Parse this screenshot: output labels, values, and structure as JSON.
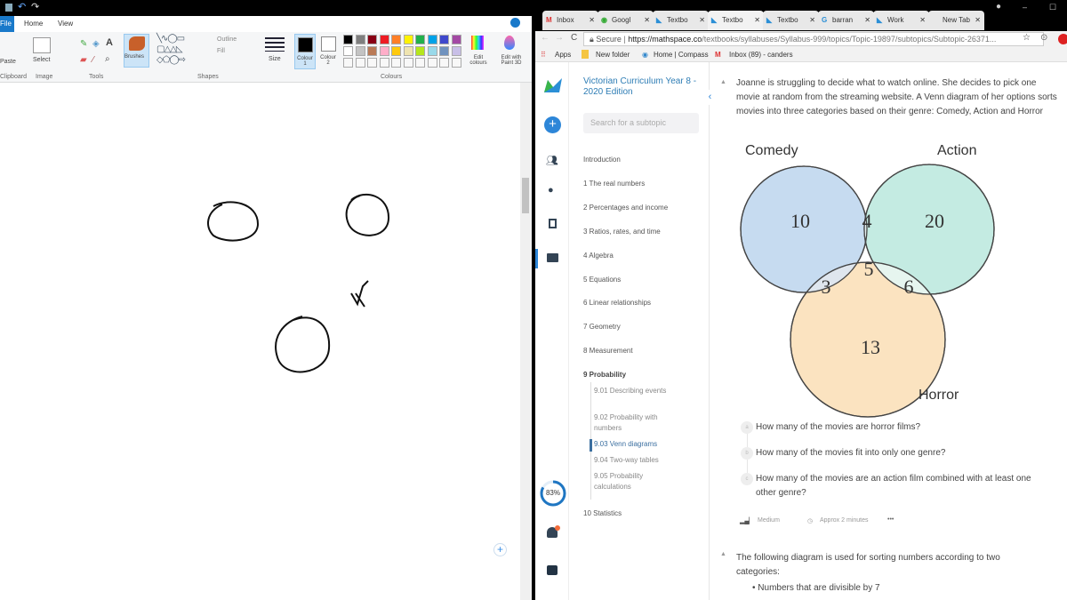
{
  "paint": {
    "quick_access": [
      "save-icon",
      "undo-icon",
      "redo-icon"
    ],
    "tabs": [
      "File",
      "Home",
      "View"
    ],
    "groups": {
      "clipboard": "Clipboard",
      "image": "Image",
      "tools": "Tools",
      "shapes": "Shapes",
      "colours": "Colours"
    },
    "buttons": {
      "paste": "Paste",
      "select": "Select",
      "brushes": "Brushes",
      "outline": "Outline",
      "fill": "Fill",
      "size": "Size",
      "colour1": "Colour 1",
      "colour2": "Colour 2",
      "edit_colours": "Edit colours",
      "edit_paint3d": "Edit with Paint 3D"
    },
    "palette_row1": [
      "#000000",
      "#7f7f7f",
      "#880015",
      "#ed1c24",
      "#ff7f27",
      "#fff200",
      "#22b14c",
      "#00a2e8",
      "#3f48cc",
      "#a349a4"
    ],
    "palette_row2": [
      "#ffffff",
      "#c3c3c3",
      "#b97a57",
      "#ffaec9",
      "#ffc90e",
      "#efe4b0",
      "#b5e61d",
      "#99d9ea",
      "#7092be",
      "#c8bfe7"
    ],
    "colour1": "#000000",
    "colour2": "#ffffff"
  },
  "browser": {
    "tabs": [
      {
        "label": "Inbox",
        "icon": "gmail-icon"
      },
      {
        "label": "Googl",
        "icon": "google-icon"
      },
      {
        "label": "Textbo",
        "icon": "mathspace-icon"
      },
      {
        "label": "Textbo",
        "icon": "mathspace-icon",
        "active": true
      },
      {
        "label": "Textbo",
        "icon": "mathspace-icon"
      },
      {
        "label": "barran",
        "icon": "google-g-icon"
      },
      {
        "label": "Work",
        "icon": "mathspace-icon"
      },
      {
        "label": "New Tab",
        "icon": ""
      }
    ],
    "secure": "Secure",
    "url_domain": "https://mathspace.co",
    "url_path": "/textbooks/syllabuses/Syllabus-999/topics/Topic-19897/subtopics/Subtopic-26371...",
    "bookmarks": [
      "Apps",
      "New folder",
      "Home | Compass",
      "Inbox (89) - canders"
    ]
  },
  "mathspace": {
    "sidebar": {
      "title": "Victorian Curriculum Year 8 - 2020 Edition",
      "search_placeholder": "Search for a subtopic",
      "items": [
        "Introduction",
        "1 The real numbers",
        "2 Percentages and income",
        "3 Ratios, rates, and time",
        "4 Algebra",
        "5 Equations",
        "6 Linear relationships",
        "7 Geometry",
        "8 Measurement",
        "9 Probability",
        "10 Statistics"
      ],
      "subitems": [
        "9.01 Describing events",
        "9.02 Probability with numbers",
        "9.03 Venn diagrams",
        "9.04 Two-way tables",
        "9.05 Probability calculations"
      ],
      "active_subitem": "9.03 Venn diagrams"
    },
    "progress": "83%",
    "progress_value": 0.83,
    "question1": {
      "text": "Joanne is struggling to decide what to watch online. She decides to pick one movie at random from the streaming website. A Venn diagram of her options sorts movies into three categories based on their genre: Comedy, Action and Horror",
      "venn": {
        "sets": [
          "Comedy",
          "Action",
          "Horror"
        ],
        "colors": {
          "Comedy": "#c6dbf0",
          "Action": "#c4ebe2",
          "Horror": "#fbe3c0"
        },
        "regions": {
          "comedy_only": "10",
          "comedy_action": "4",
          "action_only": "20",
          "all": "5",
          "comedy_horror": "3",
          "action_horror": "6",
          "horror_only": "13"
        }
      },
      "parts": [
        {
          "letter": "a",
          "text": "How many of the movies are horror films?"
        },
        {
          "letter": "b",
          "text": "How many of the movies fit into only one genre?"
        },
        {
          "letter": "c",
          "text": "How many of the movies are an action film combined with at least one other genre?"
        }
      ],
      "difficulty": "Medium",
      "time": "Approx 2 minutes",
      "more": "•••"
    },
    "question2": {
      "text": "The following diagram is used for sorting numbers according to two categories:",
      "bullet": "Numbers that are divisible by 7"
    }
  }
}
